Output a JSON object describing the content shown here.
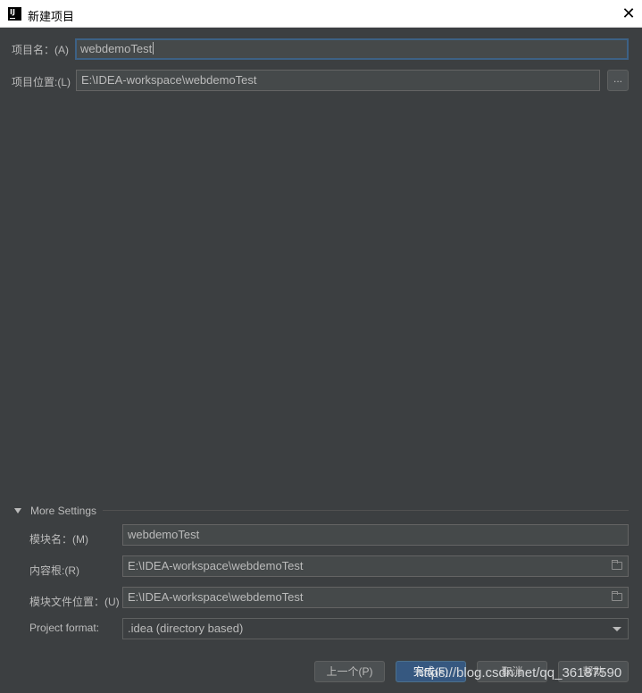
{
  "window": {
    "title": "新建项目",
    "icon_text": "IJ",
    "close_glyph": "✕"
  },
  "project": {
    "name_label": "项目名：(A)",
    "name_value": "webdemoTest",
    "location_label": "项目位置:(L)",
    "location_value": "E:\\IDEA-workspace\\webdemoTest",
    "browse_label": "..."
  },
  "more_settings": {
    "title": "More Settings",
    "expanded": true,
    "module_name_label": "模块名：(M)",
    "module_name_value": "webdemoTest",
    "content_root_label": "内容根:(R)",
    "content_root_value": "E:\\IDEA-workspace\\webdemoTest",
    "module_file_label": "模块文件位置：(U)",
    "module_file_value": "E:\\IDEA-workspace\\webdemoTest",
    "format_label": "Project format:",
    "format_value": ".idea (directory based)"
  },
  "buttons": {
    "previous": "上一个(P)",
    "finish": "完成(F)",
    "cancel": "取消",
    "help": "帮助"
  },
  "watermark": "https://blog.csdn.net/qq_36187590",
  "colors": {
    "background": "#3c3f41",
    "field_background": "#45494a",
    "focus_border": "#3d6185",
    "primary_button": "#365880",
    "text": "#bbbbbb"
  }
}
